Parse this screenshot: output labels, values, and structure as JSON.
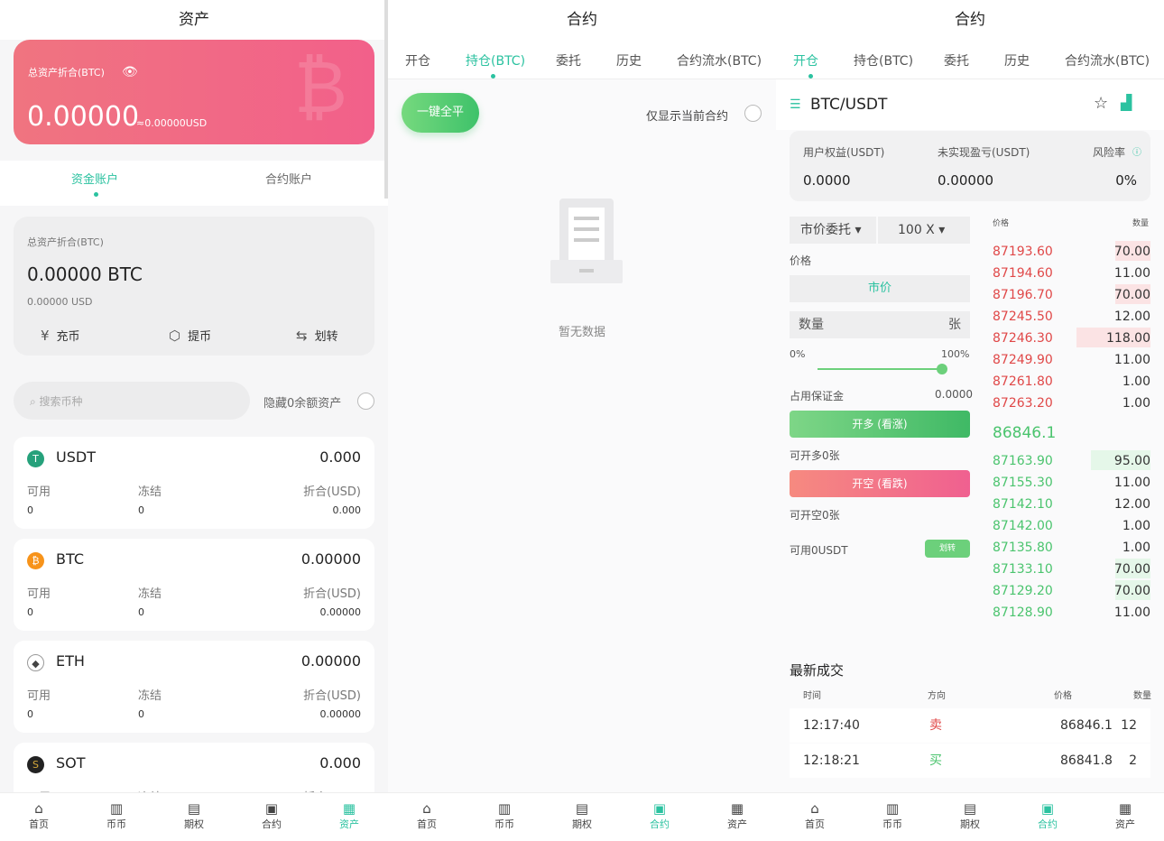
{
  "assets": {
    "title": "资产",
    "card": {
      "label": "总资产折合(BTC)",
      "value": "0.00000",
      "usd": "≈0.00000USD"
    },
    "tabs": [
      "资金账户",
      "合约账户"
    ],
    "summary": {
      "label": "总资产折合(BTC)",
      "btc": "0.00000 BTC",
      "usd": "0.00000 USD"
    },
    "actions": [
      "充币",
      "提币",
      "划转"
    ],
    "search_placeholder": "搜索币种",
    "hide_zero": "隐藏0余额资产",
    "coins": [
      {
        "name": "USDT",
        "total": "0.000",
        "available_label": "可用",
        "frozen_label": "冻结",
        "conv_label": "折合(USD)",
        "available": "0",
        "frozen": "0",
        "conv": "0.000",
        "color": "#26a17b",
        "glyph": "T"
      },
      {
        "name": "BTC",
        "total": "0.00000",
        "available_label": "可用",
        "frozen_label": "冻结",
        "conv_label": "折合(USD)",
        "available": "0",
        "frozen": "0",
        "conv": "0.00000",
        "color": "#f7931a",
        "glyph": "₿"
      },
      {
        "name": "ETH",
        "total": "0.00000",
        "available_label": "可用",
        "frozen_label": "冻结",
        "conv_label": "折合(USD)",
        "available": "0",
        "frozen": "0",
        "conv": "0.00000",
        "color": "#555555",
        "glyph": "◆"
      },
      {
        "name": "SOT",
        "total": "0.000",
        "available_label": "可用",
        "frozen_label": "冻结",
        "conv_label": "折合(USD)",
        "available": "",
        "frozen": "",
        "conv": "",
        "color": "#222222",
        "glyph": "S"
      }
    ]
  },
  "contract_hold": {
    "title": "合约",
    "tabs": [
      "开仓",
      "持仓(BTC)",
      "委托",
      "历史",
      "合约流水(BTC)"
    ],
    "close_all": "一键全平",
    "only_current": "仅显示当前合约",
    "empty": "暂无数据"
  },
  "contract_open": {
    "title": "合约",
    "tabs": [
      "开仓",
      "持仓(BTC)",
      "委托",
      "历史",
      "合约流水(BTC)"
    ],
    "pair": "BTC/USDT",
    "equity_label": "用户权益(USDT)",
    "equity": "0.0000",
    "pnl_label": "未实现盈亏(USDT)",
    "pnl": "0.00000",
    "risk_label": "风险率",
    "risk": "0%",
    "order_type": "市价委托",
    "leverage": "100 X",
    "price_label": "价格",
    "price_value": "市价",
    "qty_placeholder": "数量",
    "qty_unit": "张",
    "slider_min": "0%",
    "slider_max": "100%",
    "slider_value": 1.0,
    "margin_label": "占用保证金",
    "margin": "0.0000",
    "long_btn": "开多 (看涨)",
    "can_long": "可开多0张",
    "short_btn": "开空 (看跌)",
    "can_short": "可开空0张",
    "available": "可用0USDT",
    "transfer": "划转",
    "ob_price_h": "价格",
    "ob_qty_h": "数量",
    "asks": [
      {
        "p": "87193.60",
        "q": "70.00",
        "depth": 0.47
      },
      {
        "p": "87194.60",
        "q": "11.00",
        "depth": 0
      },
      {
        "p": "87196.70",
        "q": "70.00",
        "depth": 0.47
      },
      {
        "p": "87245.50",
        "q": "12.00",
        "depth": 0
      },
      {
        "p": "87246.30",
        "q": "118.00",
        "depth": 1.0
      },
      {
        "p": "87249.90",
        "q": "11.00",
        "depth": 0
      },
      {
        "p": "87261.80",
        "q": "1.00",
        "depth": 0
      },
      {
        "p": "87263.20",
        "q": "1.00",
        "depth": 0
      }
    ],
    "mid": "86846.1",
    "bids": [
      {
        "p": "87163.90",
        "q": "95.00",
        "depth": 0.8
      },
      {
        "p": "87155.30",
        "q": "11.00",
        "depth": 0
      },
      {
        "p": "87142.10",
        "q": "12.00",
        "depth": 0
      },
      {
        "p": "87142.00",
        "q": "1.00",
        "depth": 0
      },
      {
        "p": "87135.80",
        "q": "1.00",
        "depth": 0
      },
      {
        "p": "87133.10",
        "q": "70.00",
        "depth": 0.47
      },
      {
        "p": "87129.20",
        "q": "70.00",
        "depth": 0.47
      },
      {
        "p": "87128.90",
        "q": "11.00",
        "depth": 0
      }
    ],
    "trades_title": "最新成交",
    "trades_headers": [
      "时间",
      "方向",
      "价格",
      "数量"
    ],
    "trades": [
      {
        "t": "12:17:40",
        "d": "卖",
        "p": "86846.1",
        "q": "12",
        "side": "sell"
      },
      {
        "t": "12:18:21",
        "d": "买",
        "p": "86841.8",
        "q": "2",
        "side": "buy"
      }
    ]
  },
  "tabbar": [
    "首页",
    "币币",
    "期权",
    "合约",
    "资产"
  ]
}
